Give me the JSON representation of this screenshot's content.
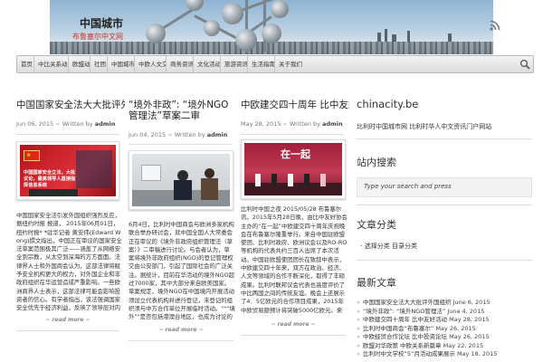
{
  "header": {
    "site_title": "中国城市",
    "tagline": "布鲁塞尔中文网",
    "rss_icon": "rss-icon"
  },
  "nav": {
    "items": [
      "首页",
      "中比关系动态",
      "欧盟动态",
      "社团",
      "中国城市",
      "中欧人文交流",
      "商务资讯",
      "文化活动",
      "旅游资讯",
      "生活指南",
      "关于我们"
    ],
    "search_icon": "search-icon"
  },
  "posts": [
    {
      "title": "中国国家安全法大大批评外国组织",
      "date": "Jun 06, 2015",
      "written_by": "Written by",
      "author": "admin",
      "thumb_caption": "中国国家安全立法，大批议论，最高领导人直接指挥信息系统",
      "excerpt": "中国国家安全法引发外国组织强烈反应，据纽约时报 报道， 2015年06月01日， 纽约时报* *驻华记者 黄安伟(Edward Wong)撰文指出，中国正在审议的国家安全法草案范围极其广泛——涵盖了从网络安全到宗教，从太空到深海的方方面面。法律界人士和外国商会认为，这部法律将赋予安全机构更大的权力，对外国企业和非政府组织在华运营造成严重影响。一些欧洲商界人士表示，这部法律可能会影响投资者的信心。有学者指出，该法强调国家安全优先于经济利益，反映了领导层对内外威胁的高度警惕。 [...]",
      "read_more": "~ read more ~"
    },
    {
      "title": "“境外非政”: “境外NGO管理法”草案二审",
      "date": "Jun 04, 2015",
      "written_by": "Written by",
      "author": "admin",
      "excerpt": "6月4日，比利时中国商会与欧洲多家机构联合举办研讨会，就中国全国人大常委会正在审议的《境外非政府组织管理法（草案）》二审稿进行讨论。与会者认为，草案将境外非政府组织(NGO)的登记管理权交由公安部门，引起了国际社会的广泛关注。据统计，目前在华活动的境外NGO超过7000家，其中大部分来自欧美国家。草案规定，境外NGO在中国境内开展活动须设立代表机构并进行登记，未登记的组织须与中方合作单位开展临时活动。\"\"“境外”\"是否包括港澳台地区，也成为讨论的焦点之一。专家建议在立法过程中充分听取各方意见，\"“境”\"界定 [...]",
      "read_more": "~ read more ~"
    },
    {
      "title": "中欧建交四十周年 比中友好活动",
      "date": "May 28, 2015",
      "written_by": "Written by",
      "author": "admin",
      "thumb_caption": "在一起",
      "excerpt": "比利时中国之夜 2015/05/28 布鲁塞尔讯，2015年5月28日晚，由比中友好协会主办的“在一起”中欧建交四十周年庆祝晚会在布鲁塞尔隆重举行。来自中国驻欧盟使团、比利时政府、欧洲议会以及RO-RO等机构的代表共约三百人出席了本次活动。中国驻欧盟使团团长在致辞中表示，中欧建交四十年来，双方在政治、经济、人文等领域的合作不断深化，取得了丰硕成果。比利时联邦议会代表也高度评价了中比两国之间的传统友谊。晚会上还展示了4．5亿欧元的合作项目成果，2015年中欧贸易额预计将突破5000亿欧元。来自两国的艺术家同台献艺，现场气氛热烈。活动在欢乐的歌声中圆满落下帷幕，成为中欧友好交流的又一佳话。 [...]",
      "read_more": "~ read more ~"
    }
  ],
  "sidebar": {
    "site_name": "chinacity.be",
    "site_desc": "比利时中国城市网 比利时华人中文资讯门户网站",
    "search_heading": "站内搜索",
    "search_placeholder": "Type your search and press",
    "category_heading": "文章分类",
    "category_item": "- 选择分类 目录分类",
    "recent_heading": "最新文章",
    "recent_posts": [
      {
        "title": "中国国家安全法大大批评外国组织",
        "date": "June 6, 2015"
      },
      {
        "title": "“境外非政”: “境外NGO管理法”",
        "date": "June 4, 2015"
      },
      {
        "title": "中欧建交四十周年 比中友好活动",
        "date": "May 28, 2015"
      },
      {
        "title": "比利时中国商会“布鲁塞尔”",
        "date": "May 26, 2015"
      },
      {
        "title": "中欧经贸合作论坛 比中投资论坛",
        "date": "May 26, 2015"
      },
      {
        "title": "欧盟对华政策 中欧关系新篇章",
        "date": "May 22, 2015"
      },
      {
        "title": "比利时中文学校“5”月活动成果展示",
        "date": "May 18, 2015"
      }
    ]
  },
  "colors": {
    "tagline": "#c0392b",
    "nav_bg": "#e5e5e5",
    "text": "#333333"
  }
}
